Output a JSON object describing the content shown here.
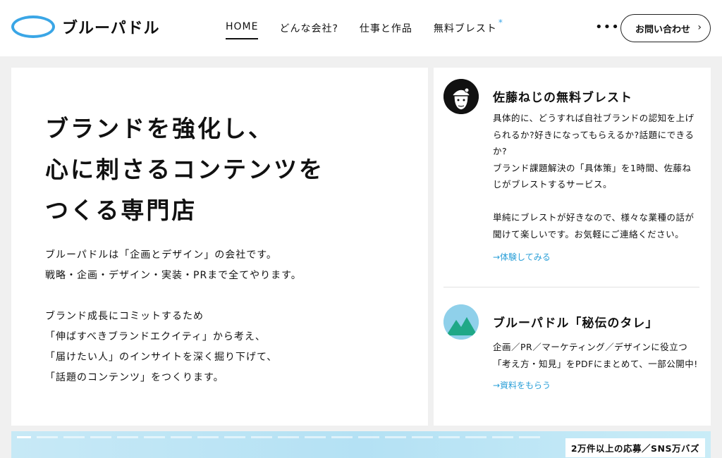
{
  "header": {
    "logo_text": "ブルーパドル",
    "nav": [
      {
        "label": "HOME"
      },
      {
        "label": "どんな会社?"
      },
      {
        "label": "仕事と作品"
      },
      {
        "label": "無料ブレスト"
      }
    ],
    "nav_star": "*",
    "more_label": "•••",
    "contact_label": "お問い合わせ",
    "contact_chevron": "›",
    "accent_color": "#3aa6e6"
  },
  "hero": {
    "title_lines": [
      "ブランドを強化し、",
      "心に刺さるコンテンツを",
      "つくる専門店"
    ],
    "body_lines": [
      "ブルーパドルは「企画とデザイン」の会社です。",
      "戦略・企画・デザイン・実装・PRまで全てやります。",
      "ブランド成長にコミットするため",
      "「伸ばすべきブランドエクイティ」から考え、",
      "「届けたい人」のインサイトを深く掘り下げて、",
      "「話題のコンテンツ」をつくります。"
    ]
  },
  "side": {
    "brainstorm": {
      "icon": "person-avatar-icon",
      "title": "佐藤ねじの無料ブレスト",
      "desc_lines": [
        "具体的に、どうすれば自社ブランドの認知を上げ",
        "られるか?好きになってもらえるか?話題にできる",
        "か?",
        "ブランド課題解決の「具体策」を1時間、佐藤ね",
        "じがブレストするサービス。",
        "単純にブレストが好きなので、様々な業種の話が",
        "聞けて楽しいです。お気軽にご連絡ください。"
      ],
      "link": "→体験してみる"
    },
    "secret": {
      "icon": "mountain-icon",
      "title": "ブルーパドル「秘伝のタレ」",
      "desc_lines": [
        "企画／PR／マーケティング／デザインに役立つ",
        "「考え方・知見」をPDFにまとめて、一部公開中!"
      ],
      "link": "→資料をもらう"
    }
  },
  "banner": {
    "label": "2万件以上の応募／SNS万バズ",
    "slide_count": 20,
    "active_slide": 1
  }
}
